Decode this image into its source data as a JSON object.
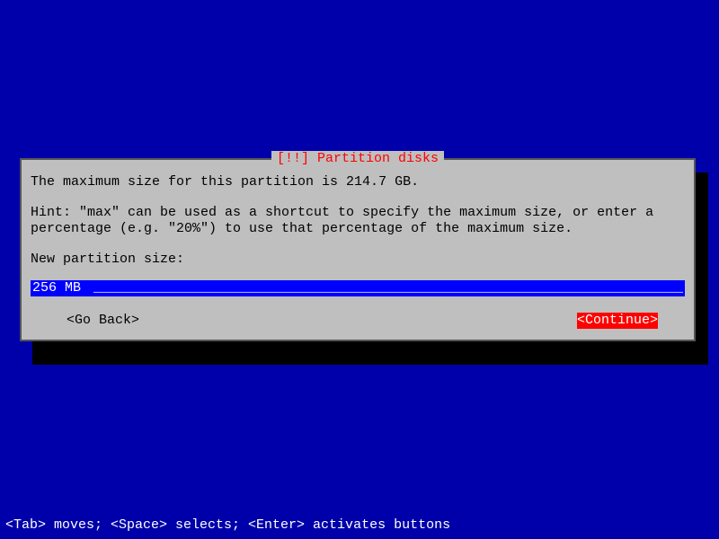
{
  "dialog": {
    "title": "[!!] Partition disks",
    "max_size_text": "The maximum size for this partition is 214.7 GB.",
    "hint_text": "Hint: \"max\" can be used as a shortcut to specify the maximum size, or enter a percentage (e.g. \"20%\") to use that percentage of the maximum size.",
    "field_label": "New partition size:",
    "input_value": "256 MB",
    "go_back_label": "<Go Back>",
    "continue_label": "<Continue>"
  },
  "help_bar": "<Tab> moves; <Space> selects; <Enter> activates buttons",
  "colors": {
    "background": "#0000aa",
    "panel": "#bfbfbf",
    "title_fg": "#f00",
    "input_bg": "#0000ff",
    "continue_bg": "#f00"
  }
}
